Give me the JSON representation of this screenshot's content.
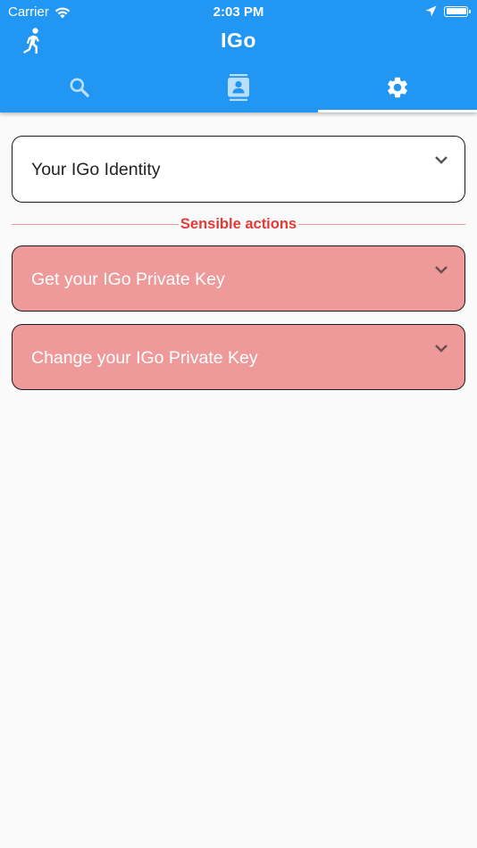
{
  "status_bar": {
    "carrier": "Carrier",
    "time": "2:03 PM"
  },
  "app_bar": {
    "title": "IGo",
    "leading_icon": "person-running-icon",
    "tabs": [
      {
        "icon": "search-icon",
        "selected": false
      },
      {
        "icon": "contact-card-icon",
        "selected": false
      },
      {
        "icon": "gear-icon",
        "selected": true
      }
    ]
  },
  "panels": {
    "identity_label": "Your IGo Identity",
    "divider_label": "Sensible actions",
    "get_key_label": "Get your IGo Private Key",
    "change_key_label": "Change your IGo Private Key"
  },
  "colors": {
    "app_bar": "#2196f3",
    "danger_panel": "#ef9a9a",
    "danger_text": "#e53935",
    "background": "#fafafa"
  }
}
